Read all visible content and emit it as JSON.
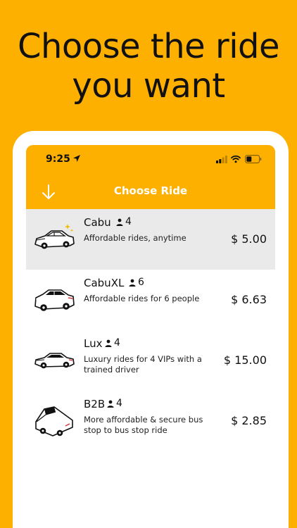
{
  "headline": {
    "line1": "Choose the ride",
    "line2": "you want"
  },
  "status_bar": {
    "time": "9:25"
  },
  "app_bar": {
    "title": "Choose Ride",
    "back_icon": "arrow-down-icon"
  },
  "rides": [
    {
      "name": "Cabu",
      "capacity": "4",
      "description": "Affordable rides, anytime",
      "price": "$ 5.00",
      "selected": true
    },
    {
      "name": "CabuXL",
      "capacity": "6",
      "description": "Affordable rides for 6 people",
      "price": "$ 6.63",
      "selected": false
    },
    {
      "name": "Lux",
      "capacity": "4",
      "description": "Luxury rides for 4 VIPs with a trained driver",
      "price": "$ 15.00",
      "selected": false
    },
    {
      "name": "B2B",
      "capacity": "4",
      "description": "More affordable & secure bus stop to bus stop ride",
      "price": "$ 2.85",
      "selected": false
    }
  ],
  "colors": {
    "brand": "#FEB001",
    "selected_row": "#EAEAEA"
  }
}
